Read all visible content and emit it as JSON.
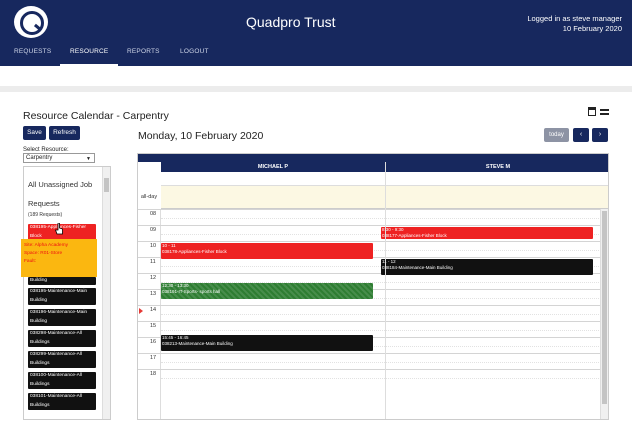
{
  "header": {
    "title": "Quadpro Trust",
    "login_line1": "Logged in as steve manager",
    "login_line2": "10 February 2020"
  },
  "nav": {
    "items": [
      "REQUESTS",
      "RESOURCE",
      "REPORTS",
      "LOGOUT"
    ],
    "active": "RESOURCE"
  },
  "page": {
    "title": "Resource Calendar - Carpentry"
  },
  "toolbar": {
    "save_label": "Save",
    "refresh_label": "Refresh"
  },
  "resource_select": {
    "label": "Select Resource:",
    "value": "Carpentry"
  },
  "unassigned": {
    "title": "All Unassigned Job Requests",
    "count": "(189 Requests)",
    "items": [
      {
        "text": "038195-Appliances-Fisher Block",
        "color": "red"
      },
      {
        "text": "Building",
        "color": "black"
      },
      {
        "text": "038195-Maintenance-Main Building",
        "color": "black"
      },
      {
        "text": "038196-Maintenance-Main Building",
        "color": "black"
      },
      {
        "text": "038298-Maintenance-All Buildings",
        "color": "black"
      },
      {
        "text": "038299-Maintenance-All Buildings",
        "color": "black"
      },
      {
        "text": "038100-Maintenance-All Buildings",
        "color": "black"
      },
      {
        "text": "038101-Maintenance-All Buildings",
        "color": "black"
      }
    ],
    "tooltip": {
      "site": "Site: Alpha Academy",
      "space": "Space: R01-Store",
      "fault": "Fault:"
    }
  },
  "calendar": {
    "date": "Monday, 10 February 2020",
    "today_label": "today",
    "prev_icon": "‹",
    "next_icon": "›",
    "resources": [
      "MICHAEL P",
      "STEVE M"
    ],
    "allday_label": "all-day",
    "hours": [
      "08",
      "09",
      "10",
      "11",
      "12",
      "13",
      "14",
      "15",
      "16",
      "17",
      "18"
    ],
    "events": [
      {
        "resource": 1,
        "start": 9.0,
        "end": 9.5,
        "time": "8:30 - 9:30",
        "text": "038177-Appliances-Fisher Block",
        "color": "red"
      },
      {
        "resource": 0,
        "start": 10.0,
        "end": 11.0,
        "time": "10 - 11",
        "text": "038178-Appliances-Fisher Block",
        "color": "red"
      },
      {
        "resource": 1,
        "start": 11.0,
        "end": 12.0,
        "time": "11 - 12",
        "text": "038184-Maintenance-Main Building",
        "color": "black"
      },
      {
        "resource": 0,
        "start": 12.5,
        "end": 13.5,
        "time": "12:30 - 13:30",
        "text": "038191-IT-Sports- sports hall",
        "color": "green"
      },
      {
        "resource": 0,
        "start": 15.75,
        "end": 16.75,
        "time": "15:45 - 16:45",
        "text": "038213-Maintenance-Main Building",
        "color": "black"
      }
    ]
  },
  "colors": {
    "brand": "#17285e",
    "red": "#ee2222",
    "green": "#2e7d32",
    "tooltip": "#fbb710",
    "allday": "#fcf8e3"
  }
}
